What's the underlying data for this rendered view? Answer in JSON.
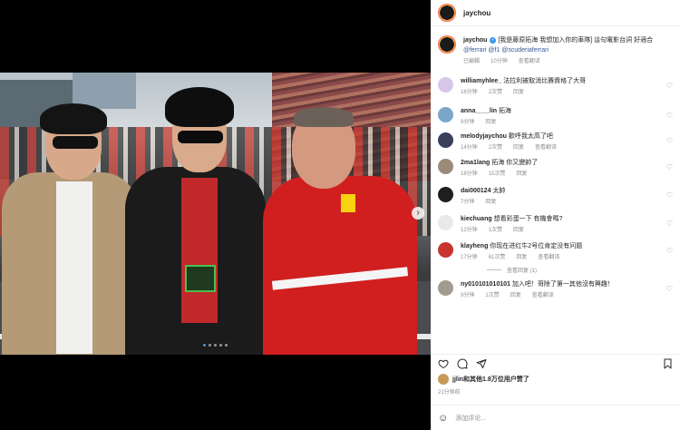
{
  "header": {
    "username": "jaychou"
  },
  "caption": {
    "username": "jaychou",
    "text": "[我是藤原拓海 我想加入你的車隊] 這句電影台詞 好適合",
    "mentions": "@ferrari @f1 @scuderiaferrari",
    "status": "已編輯",
    "time": "10分钟",
    "translate": "查看翻译"
  },
  "comments": [
    {
      "username": "williamyhlee_",
      "text": "法拉利被取消比賽資格了大哥",
      "time": "16分钟",
      "likes": "2次赞",
      "reply": "回复",
      "avatar_color": "#d8c6e8"
    },
    {
      "username": "anna____lin",
      "text": "拓海",
      "time": "9分钟",
      "likes": "",
      "reply": "回复",
      "avatar_color": "#7aa7c7"
    },
    {
      "username": "melodyjaychou",
      "text": "歡呼我太高了吧",
      "time": "14分钟",
      "likes": "2次赞",
      "reply": "回复",
      "translate": "查看翻译",
      "avatar_color": "#3a3f5c"
    },
    {
      "username": "2ma1lang",
      "text": "拓海 你又變帥了",
      "time": "18分钟",
      "likes": "15次赞",
      "reply": "回复",
      "avatar_color": "#9b8c7a"
    },
    {
      "username": "dai000124",
      "text": "太帥",
      "time": "7分钟",
      "likes": "",
      "reply": "回复",
      "avatar_color": "#1e1e1e"
    },
    {
      "username": "kiechuang",
      "text": "想看彩蛋一下 有機會嗎?",
      "time": "12分钟",
      "likes": "1次赞",
      "reply": "回复",
      "avatar_color": "#e9e9e9"
    },
    {
      "username": "klayheng",
      "text": "你现在进红牛2号位肯定没有问题",
      "time": "17分钟",
      "likes": "61次赞",
      "reply": "回复",
      "translate": "查看翻译",
      "avatar_color": "#c8342e",
      "replies": "查看回复 (1)"
    },
    {
      "username": "ny010101010101",
      "text": "加入吧！哥除了第一其他沒有興趣！",
      "time": "9分钟",
      "likes": "1次赞",
      "reply": "回复",
      "translate": "查看翻译",
      "avatar_color": "#a39a8f"
    }
  ],
  "likes": {
    "text": "jjlin和其他1.8万位用户赞了"
  },
  "posted": {
    "text": "21分钟前"
  },
  "comment_input": {
    "placeholder": "添加评论..."
  },
  "icons": {
    "like": "heart-icon",
    "comment": "comment-icon",
    "share": "send-icon",
    "save": "bookmark-icon",
    "emoji": "smiley-icon",
    "carousel_next": "chevron-right-icon",
    "verified": "verified-badge-icon"
  },
  "colors": {
    "accent": "#3897f0",
    "link": "#385898",
    "muted": "#8e8e8e"
  }
}
